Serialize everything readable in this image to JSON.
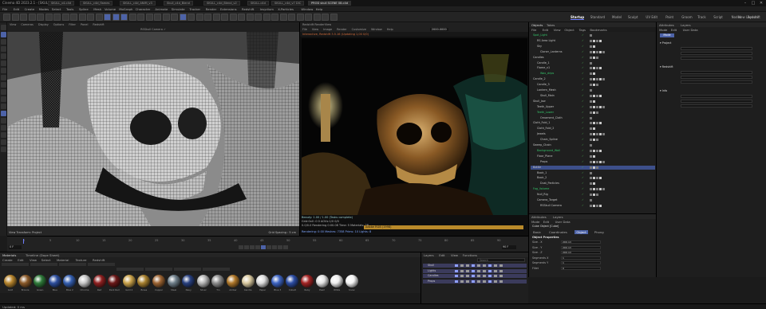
{
  "window": {
    "title": "Cinema 4D 2023.2.1 - [SKULL.c4d] - Main",
    "tabs": [
      "SKULL_v4.c4d",
      "SKULL_c4d_flames",
      "SKULL_c4d_ANIM_v3",
      "Skull_c4d_Blend",
      "SKULL_c4d_Blend_v2",
      "SKULL.c4d",
      "SKULL_c4d_v7 DIC",
      "PROD skull SCENE 08.c4d"
    ],
    "minimize": "–",
    "maximize": "□",
    "close": "✕"
  },
  "menubar": {
    "items": [
      "File",
      "Edit",
      "Create",
      "Modes",
      "Select",
      "Tools",
      "Spline",
      "Mesh",
      "Volume",
      "MoGraph",
      "Character",
      "Animate",
      "Simulate",
      "Tracker",
      "Render",
      "Extensions",
      "Redshift",
      "Insydium",
      "X-Particles",
      "Window",
      "Help"
    ],
    "layouts": [
      "Startup",
      "Standard",
      "Model",
      "Sculpt",
      "UV Edit",
      "Paint",
      "Groom",
      "Track",
      "Script",
      "Nodes",
      "Redshift"
    ],
    "new_layouts": "New Layouts"
  },
  "viewport": {
    "menu": [
      "View",
      "Cameras",
      "Display",
      "Options",
      "Filter",
      "Panel",
      "Redshift"
    ],
    "camera": "RSSkull Camera  ✓",
    "bottom_left": "View Transform: Project",
    "bottom_right": "Grid Spacing : 5 cm"
  },
  "renderview": {
    "menu": [
      "File",
      "View",
      "Image",
      "Render",
      "Customize",
      "Window",
      "Help"
    ],
    "title": "Redshift RenderView",
    "info": "Interactive, Redshift 3.5.16 (Updating 1,00 0/0)",
    "stats": [
      "Beauty: 1.00 / 1.00 (Tasks complete)",
      "Grid:0x0 :0 0    AOVs:1/0 0/0",
      "0.0/0.0 Rendering 0:00.08 Time: 5 Materials: 28",
      "Rendering: 0:00  Meshes: 7358  Prims: 10 Lights: 8"
    ],
    "frame": "2000.0000 ",
    "bar_label": "Adobe RGB (1998)"
  },
  "object_manager": {
    "tabs": [
      "Objects",
      "Takes"
    ],
    "menu": [
      "File",
      "Edit",
      "View",
      "Object",
      "Tags",
      "Bookmarks"
    ],
    "objects": [
      "Spot_Light",
      "RS Area Light",
      "Sky",
      "Cloner_Lanterns",
      "Candles",
      "Candle_1",
      "Flame_v1",
      "Wax_drips",
      "Candle_2",
      "Candle_3",
      "Lantern_Mesh",
      "Skull_Main",
      "Skull_Jaw",
      "Teeth_Upper",
      "Teeth_Lower",
      "Ornament_Cloth",
      "Cloth_Fold_1",
      "Cloth_Fold_2",
      "Jewels",
      "Chain_Spline",
      "Sweep_Chain",
      "Background_Wall",
      "Floor_Plane",
      "Props",
      "Bottle",
      "Book_1",
      "Book_2",
      "Dust_Particles",
      "Fog_Volume",
      "Null_Rig",
      "Camera_Target",
      "RSSkull Camera"
    ]
  },
  "attribute_manager": {
    "tabs": [
      "Attributes",
      "Layers"
    ],
    "menu": [
      "Mode",
      "Edit",
      "User Data"
    ],
    "object": "Cube Object [Cube]",
    "subtabs": [
      "Basic",
      "Coordinates",
      "Object",
      "Phong"
    ],
    "section": "Object Properties",
    "fields": [
      {
        "label": "Size . X",
        "value": "200 cm"
      },
      {
        "label": "Size . Y",
        "value": "200 cm"
      },
      {
        "label": "Size . Z",
        "value": "200 cm"
      },
      {
        "label": "Segments X",
        "value": "1"
      },
      {
        "label": "Segments Y",
        "value": "1"
      },
      {
        "label": "Fillet",
        "value": "0"
      }
    ]
  },
  "right_panel": {
    "tabs": [
      "Attributes",
      "Layers"
    ],
    "menu": [
      "Mode",
      "Edit",
      "User Data"
    ],
    "mode": "Mode",
    "sections": [
      "Project",
      "Redshift",
      "Info"
    ]
  },
  "timeline": {
    "ticks": [
      "0",
      "5",
      "10",
      "15",
      "20",
      "25",
      "30",
      "35",
      "40",
      "45",
      "50",
      "55",
      "60",
      "65",
      "70",
      "75",
      "80",
      "85",
      "90"
    ],
    "current": "0 F",
    "end": "90 F"
  },
  "material_manager": {
    "tabs": [
      "Materials",
      "Timeline (Dope Sheet)"
    ],
    "menu": [
      "Create",
      "Edit",
      "View",
      "Select",
      "Material",
      "Texture",
      "Redshift"
    ],
    "materials": [
      {
        "name": "Gold",
        "color": "#b8862e"
      },
      {
        "name": "Bronze",
        "color": "#8a5a2a"
      },
      {
        "name": "Green",
        "color": "#2f7a3a"
      },
      {
        "name": "Blue",
        "color": "#2e4f9e"
      },
      {
        "name": "Blue 2",
        "color": "#355fb0"
      },
      {
        "name": "Chrome",
        "color": "#c7c7c7"
      },
      {
        "name": "Red",
        "color": "#8e2020"
      },
      {
        "name": "Dark Red",
        "color": "#6b1818"
      },
      {
        "name": "Gold 2",
        "color": "#c9a24a"
      },
      {
        "name": "Brass",
        "color": "#a8812f"
      },
      {
        "name": "Copper",
        "color": "#9c6433"
      },
      {
        "name": "Steel",
        "color": "#6f7f8a"
      },
      {
        "name": "Navy",
        "color": "#28407f"
      },
      {
        "name": "Silver",
        "color": "#b5b5b5"
      },
      {
        "name": "Tin",
        "color": "#8d8d8d"
      },
      {
        "name": "Amber",
        "color": "#b0782a"
      },
      {
        "name": "Candle",
        "color": "#d9c9a0"
      },
      {
        "name": "Paper",
        "color": "#dddddd"
      },
      {
        "name": "Blue 3",
        "color": "#3d64c2"
      },
      {
        "name": "Cobalt",
        "color": "#2d4ea5"
      },
      {
        "name": "Ruby",
        "color": "#a32424"
      },
      {
        "name": "Pearl",
        "color": "#e3e3e3"
      },
      {
        "name": "White",
        "color": "#eeeeee"
      },
      {
        "name": "Snow",
        "color": "#f5f5f5"
      }
    ]
  },
  "layer_manager": {
    "menu": [
      "Layers",
      "Edit",
      "View",
      "Functions"
    ],
    "search": "Search",
    "layers": [
      "Skull",
      "Lights",
      "Candles",
      "Props"
    ]
  },
  "statusbar": {
    "text": "Updated: 0 ms"
  },
  "colors": {
    "accent": "#6d7cff",
    "selected": "#4d63a8",
    "object_green": "#35c46a"
  }
}
